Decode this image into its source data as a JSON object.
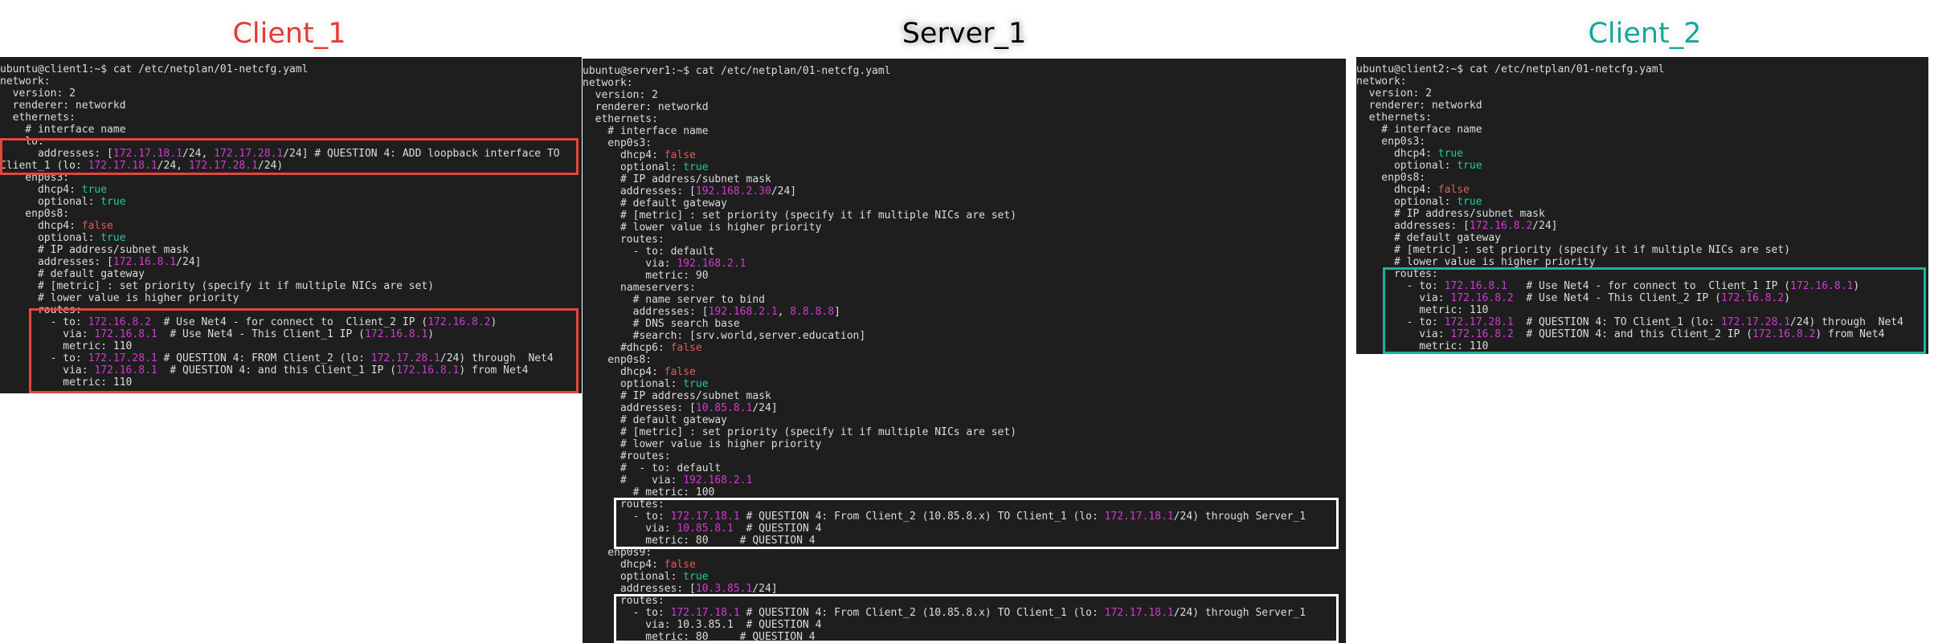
{
  "titles": {
    "client1": "Client_1",
    "server1": "Server_1",
    "client2": "Client_2"
  },
  "terminals": {
    "client1": {
      "lines": [
        [
          [
            "ubuntu@client1:~$ cat /etc/netplan/01-netcfg.yaml",
            "p"
          ]
        ],
        [
          [
            "network:",
            "p"
          ]
        ],
        [
          [
            "  version: 2",
            "p"
          ]
        ],
        [
          [
            "  renderer: networkd",
            "p"
          ]
        ],
        [
          [
            "  ethernets:",
            "p"
          ]
        ],
        [
          [
            "    # interface name",
            "p"
          ]
        ],
        [
          [
            "    lo:",
            "p"
          ]
        ],
        [
          [
            "      addresses: [",
            "p"
          ],
          [
            "172.17.18.1",
            "m"
          ],
          [
            "/24, ",
            "p"
          ],
          [
            "172.17.28.1",
            "m"
          ],
          [
            "/24] # QUESTION 4: ADD loopback interface TO",
            "p"
          ]
        ],
        [
          [
            "Client_1 (lo: ",
            "p"
          ],
          [
            "172.17.18.1",
            "m"
          ],
          [
            "/24, ",
            "p"
          ],
          [
            "172.17.28.1",
            "m"
          ],
          [
            "/24)",
            "p"
          ]
        ],
        [
          [
            "    enp0s3:",
            "p"
          ]
        ],
        [
          [
            "      dhcp4: ",
            "p"
          ],
          [
            "true",
            "g"
          ]
        ],
        [
          [
            "      optional: ",
            "p"
          ],
          [
            "true",
            "g"
          ]
        ],
        [
          [
            "    enp0s8:",
            "p"
          ]
        ],
        [
          [
            "      dhcp4: ",
            "p"
          ],
          [
            "false",
            "r"
          ]
        ],
        [
          [
            "      optional: ",
            "p"
          ],
          [
            "true",
            "g"
          ]
        ],
        [
          [
            "      # IP address/subnet mask",
            "p"
          ]
        ],
        [
          [
            "      addresses: [",
            "p"
          ],
          [
            "172.16.8.1",
            "m"
          ],
          [
            "/24]",
            "p"
          ]
        ],
        [
          [
            "      # default gateway",
            "p"
          ]
        ],
        [
          [
            "      # [metric] : set priority (specify it if multiple NICs are set)",
            "p"
          ]
        ],
        [
          [
            "      # lower value is higher priority",
            "p"
          ]
        ],
        [
          [
            "      routes:",
            "p"
          ]
        ],
        [
          [
            "        - to: ",
            "p"
          ],
          [
            "172.16.8.2",
            "m"
          ],
          [
            "  # Use Net4 - for connect to  Client_2 IP (",
            "p"
          ],
          [
            "172.16.8.2",
            "m"
          ],
          [
            ")",
            "p"
          ]
        ],
        [
          [
            "          via: ",
            "p"
          ],
          [
            "172.16.8.1",
            "m"
          ],
          [
            "  # Use Net4 - This Client_1 IP (",
            "p"
          ],
          [
            "172.16.8.1",
            "m"
          ],
          [
            ")",
            "p"
          ]
        ],
        [
          [
            "          metric: 110",
            "p"
          ]
        ],
        [
          [
            "        - to: ",
            "p"
          ],
          [
            "172.17.28.1",
            "m"
          ],
          [
            " # QUESTION 4: FROM Client_2 (lo: ",
            "p"
          ],
          [
            "172.17.28.1",
            "m"
          ],
          [
            "/24) through  Net4",
            "p"
          ]
        ],
        [
          [
            "          via: ",
            "p"
          ],
          [
            "172.16.8.1",
            "m"
          ],
          [
            "  # QUESTION 4: and this Client_1 IP (",
            "p"
          ],
          [
            "172.16.8.1",
            "m"
          ],
          [
            ") from Net4",
            "p"
          ]
        ],
        [
          [
            "          metric: 110",
            "p"
          ]
        ]
      ]
    },
    "server1": {
      "lines": [
        [
          [
            "ubuntu@server1:~$ cat /etc/netplan/01-netcfg.yaml",
            "p"
          ]
        ],
        [
          [
            "network:",
            "p"
          ]
        ],
        [
          [
            "  version: 2",
            "p"
          ]
        ],
        [
          [
            "  renderer: networkd",
            "p"
          ]
        ],
        [
          [
            "  ethernets:",
            "p"
          ]
        ],
        [
          [
            "    # interface name",
            "p"
          ]
        ],
        [
          [
            "    enp0s3:",
            "p"
          ]
        ],
        [
          [
            "      dhcp4: ",
            "p"
          ],
          [
            "false",
            "r"
          ]
        ],
        [
          [
            "      optional: ",
            "p"
          ],
          [
            "true",
            "g"
          ]
        ],
        [
          [
            "      # IP address/subnet mask",
            "p"
          ]
        ],
        [
          [
            "      addresses: [",
            "p"
          ],
          [
            "192.168.2.30",
            "m"
          ],
          [
            "/24]",
            "p"
          ]
        ],
        [
          [
            "      # default gateway",
            "p"
          ]
        ],
        [
          [
            "      # [metric] : set priority (specify it if multiple NICs are set)",
            "p"
          ]
        ],
        [
          [
            "      # lower value is higher priority",
            "p"
          ]
        ],
        [
          [
            "      routes:",
            "p"
          ]
        ],
        [
          [
            "        - to: default",
            "p"
          ]
        ],
        [
          [
            "          via: ",
            "p"
          ],
          [
            "192.168.2.1",
            "m"
          ]
        ],
        [
          [
            "          metric: 90",
            "p"
          ]
        ],
        [
          [
            "      nameservers:",
            "p"
          ]
        ],
        [
          [
            "        # name server to bind",
            "p"
          ]
        ],
        [
          [
            "        addresses: [",
            "p"
          ],
          [
            "192.168.2.1",
            "m"
          ],
          [
            ", ",
            "p"
          ],
          [
            "8.8.8.8",
            "m"
          ],
          [
            "]",
            "p"
          ]
        ],
        [
          [
            "        # DNS search base",
            "p"
          ]
        ],
        [
          [
            "        #search: [srv.world,server.education]",
            "p"
          ]
        ],
        [
          [
            "      #dhcp6: ",
            "p"
          ],
          [
            "false",
            "r"
          ]
        ],
        [
          [
            "    enp0s8:",
            "p"
          ]
        ],
        [
          [
            "      dhcp4: ",
            "p"
          ],
          [
            "false",
            "r"
          ]
        ],
        [
          [
            "      optional: ",
            "p"
          ],
          [
            "true",
            "g"
          ]
        ],
        [
          [
            "      # IP address/subnet mask",
            "p"
          ]
        ],
        [
          [
            "      addresses: [",
            "p"
          ],
          [
            "10.85.8.1",
            "m"
          ],
          [
            "/24]",
            "p"
          ]
        ],
        [
          [
            "      # default gateway",
            "p"
          ]
        ],
        [
          [
            "      # [metric] : set priority (specify it if multiple NICs are set)",
            "p"
          ]
        ],
        [
          [
            "      # lower value is higher priority",
            "p"
          ]
        ],
        [
          [
            "      #routes:",
            "p"
          ]
        ],
        [
          [
            "      #  - to: default",
            "p"
          ]
        ],
        [
          [
            "      #    via: ",
            "p"
          ],
          [
            "192.168.2.1",
            "m"
          ]
        ],
        [
          [
            "        # metric: 100",
            "p"
          ]
        ],
        [
          [
            "      routes:",
            "p"
          ]
        ],
        [
          [
            "        - to: ",
            "p"
          ],
          [
            "172.17.18.1",
            "m"
          ],
          [
            " # QUESTION 4: From Client_2 (10.85.8.x) TO Client_1 (lo: ",
            "p"
          ],
          [
            "172.17.18.1",
            "m"
          ],
          [
            "/24) through Server_1",
            "p"
          ]
        ],
        [
          [
            "          via: ",
            "p"
          ],
          [
            "10.85.8.1",
            "m"
          ],
          [
            "  # QUESTION 4",
            "p"
          ]
        ],
        [
          [
            "          metric: 80     # QUESTION 4",
            "p"
          ]
        ],
        [
          [
            "    enp0s9:",
            "p"
          ]
        ],
        [
          [
            "      dhcp4: ",
            "p"
          ],
          [
            "false",
            "r"
          ]
        ],
        [
          [
            "      optional: ",
            "p"
          ],
          [
            "true",
            "g"
          ]
        ],
        [
          [
            "      addresses: [",
            "p"
          ],
          [
            "10.3.85.1",
            "m"
          ],
          [
            "/24]",
            "p"
          ]
        ],
        [
          [
            "      routes:",
            "p"
          ]
        ],
        [
          [
            "        - to: ",
            "p"
          ],
          [
            "172.17.18.1",
            "m"
          ],
          [
            " # QUESTION 4: From Client_2 (10.85.8.x) TO Client_1 (lo: ",
            "p"
          ],
          [
            "172.17.18.1",
            "m"
          ],
          [
            "/24) through Server_1",
            "p"
          ]
        ],
        [
          [
            "          via: 10.3.85.1  # QUESTION 4",
            "p"
          ]
        ],
        [
          [
            "          metric: 80     # QUESTION 4",
            "p"
          ]
        ]
      ]
    },
    "client2": {
      "lines": [
        [
          [
            "ubuntu@client2:~$ cat /etc/netplan/01-netcfg.yaml",
            "p"
          ]
        ],
        [
          [
            "network:",
            "p"
          ]
        ],
        [
          [
            "  version: 2",
            "p"
          ]
        ],
        [
          [
            "  renderer: networkd",
            "p"
          ]
        ],
        [
          [
            "  ethernets:",
            "p"
          ]
        ],
        [
          [
            "    # interface name",
            "p"
          ]
        ],
        [
          [
            "    enp0s3:",
            "p"
          ]
        ],
        [
          [
            "      dhcp4: ",
            "p"
          ],
          [
            "true",
            "g"
          ]
        ],
        [
          [
            "      optional: ",
            "p"
          ],
          [
            "true",
            "g"
          ]
        ],
        [
          [
            "    enp0s8:",
            "p"
          ]
        ],
        [
          [
            "      dhcp4: ",
            "p"
          ],
          [
            "false",
            "r"
          ]
        ],
        [
          [
            "      optional: ",
            "p"
          ],
          [
            "true",
            "g"
          ]
        ],
        [
          [
            "      # IP address/subnet mask",
            "p"
          ]
        ],
        [
          [
            "      addresses: [",
            "p"
          ],
          [
            "172.16.8.2",
            "m"
          ],
          [
            "/24]",
            "p"
          ]
        ],
        [
          [
            "      # default gateway",
            "p"
          ]
        ],
        [
          [
            "      # [metric] : set priority (specify it if multiple NICs are set)",
            "p"
          ]
        ],
        [
          [
            "      # lower value is higher priority",
            "p"
          ]
        ],
        [
          [
            "      routes:",
            "p"
          ]
        ],
        [
          [
            "        - to: ",
            "p"
          ],
          [
            "172.16.8.1",
            "m"
          ],
          [
            "   # Use Net4 - for connect to  Client_1 IP (",
            "p"
          ],
          [
            "172.16.8.1",
            "m"
          ],
          [
            ")",
            "p"
          ]
        ],
        [
          [
            "          via: ",
            "p"
          ],
          [
            "172.16.8.2",
            "m"
          ],
          [
            "  # Use Net4 - This Client_2 IP (",
            "p"
          ],
          [
            "172.16.8.2",
            "m"
          ],
          [
            ")",
            "p"
          ]
        ],
        [
          [
            "          metric: 110",
            "p"
          ]
        ],
        [
          [
            "        - to: ",
            "p"
          ],
          [
            "172.17.28.1",
            "m"
          ],
          [
            "  # QUESTION 4: TO Client_1 (lo: ",
            "p"
          ],
          [
            "172.17.28.1",
            "m"
          ],
          [
            "/24) through  Net4",
            "p"
          ]
        ],
        [
          [
            "          via: ",
            "p"
          ],
          [
            "172.16.8.2",
            "m"
          ],
          [
            "  # QUESTION 4: and this Client_2 IP (",
            "p"
          ],
          [
            "172.16.8.2",
            "m"
          ],
          [
            ") from Net4",
            "p"
          ]
        ],
        [
          [
            "          metric: 110",
            "p"
          ]
        ]
      ]
    }
  },
  "colors": {
    "magenta": "#d23ad2",
    "green": "#22c9a4",
    "red": "#e25b5b",
    "client1": "#e53935",
    "client2": "#12a89a"
  }
}
